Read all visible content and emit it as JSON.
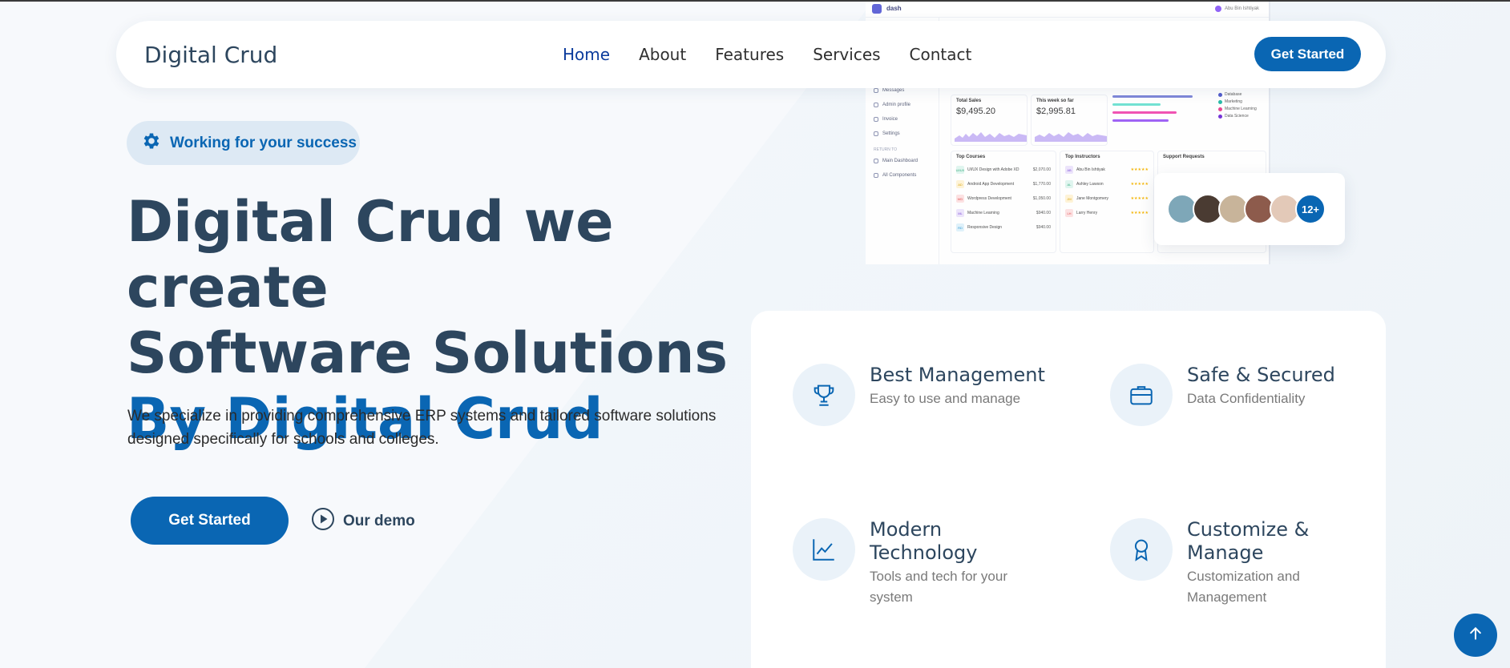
{
  "colors": {
    "primary": "#0a66b3",
    "heading": "#2d465e",
    "nav_active": "#0b3b9c",
    "page_bg": "#f3f7fb"
  },
  "navbar": {
    "brand": "Digital Crud",
    "links": [
      "Home",
      "About",
      "Features",
      "Services",
      "Contact"
    ],
    "active_link": "Home",
    "cta_label": "Get Started"
  },
  "hero": {
    "badge_icon": "gear-icon",
    "badge_text": "Working for your success",
    "title_line1": "Digital Crud we create",
    "title_line2": "Software Solutions",
    "title_accent": "By Digital Crud",
    "description": "We specialize in providing comprehensive ERP systems and tailored software solutions designed specifically for schools and colleges.",
    "cta_label": "Get Started",
    "demo_label": "Our demo",
    "demo_icon": "play-circle-icon"
  },
  "mockup": {
    "logo_text": "dash",
    "user_name": "Abu Bin Ishtiyak",
    "sidebar_items": [
      "Messages",
      "Admin profile",
      "Invoice",
      "Settings"
    ],
    "sidebar_section": "RETURN TO",
    "sidebar_links": [
      "Main Dashboard",
      "All Components"
    ],
    "total_sales": {
      "title": "Total Sales",
      "value": "$9,495.20"
    },
    "week_sales": {
      "title": "This week so far",
      "value": "$2,995.81"
    },
    "legend": [
      "Database",
      "Marketing",
      "Machine Learning",
      "Data Science"
    ],
    "top_courses": {
      "title": "Top Courses",
      "items": [
        {
          "code": "UI/UX",
          "name": "UI/UX Design with Adobe XD",
          "value": "$2,070.00"
        },
        {
          "code": "AD",
          "name": "Android App Development",
          "value": "$1,770.00"
        },
        {
          "code": "WD",
          "name": "Wordpress Development",
          "value": "$1,050.00"
        },
        {
          "code": "ML",
          "name": "Machine Learning",
          "value": "$940.00"
        },
        {
          "code": "RD",
          "name": "Responsive Design",
          "value": "$940.00"
        }
      ]
    },
    "top_instructors": {
      "title": "Top Instructors",
      "items": [
        {
          "code": "AB",
          "name": "Abu Bin Ishtiyak"
        },
        {
          "code": "AL",
          "name": "Ashley Lawson"
        },
        {
          "code": "JM",
          "name": "Jane Montgomery"
        },
        {
          "code": "LH",
          "name": "Larry Henry"
        }
      ]
    },
    "support_title": "Support Requests"
  },
  "avatars": {
    "count_label": "12+",
    "colors": [
      "#7ea7b8",
      "#4a3b32",
      "#c8b49a",
      "#8d5b4c",
      "#e3c9b8"
    ]
  },
  "features": [
    {
      "icon": "trophy-icon",
      "title": "Best Management",
      "desc": "Easy to use and manage"
    },
    {
      "icon": "briefcase-icon",
      "title": "Safe & Secured",
      "desc": "Data Confidentiality"
    },
    {
      "icon": "chart-line-icon",
      "title": "Modern Technology",
      "desc": "Tools and tech for your system"
    },
    {
      "icon": "award-icon",
      "title": "Customize & Manage",
      "desc": "Customization and Management"
    }
  ],
  "scroll_top_icon": "arrow-up-icon"
}
